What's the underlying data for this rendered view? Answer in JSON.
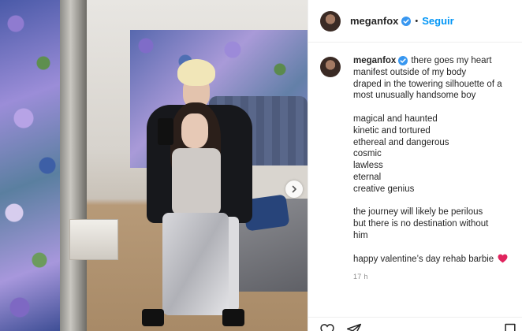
{
  "post": {
    "username": "meganfox",
    "dot": "•",
    "follow_label": "Seguir",
    "caption_lines": [
      "there goes my heart",
      "manifest outside of my body",
      "draped in the towering silhouette of a",
      "most unusually handsome boy"
    ],
    "stanza2": [
      "magical and haunted",
      "kinetic and tortured",
      "ethereal and dangerous",
      "cosmic",
      "lawless",
      "eternal",
      "creative genius"
    ],
    "stanza3": [
      "the journey will likely be perilous",
      "but there is no destination without",
      "him"
    ],
    "closing": "happy valentine’s day rehab barbie",
    "timestamp": "17 h"
  },
  "icons": {
    "verified": "verified-badge-icon",
    "heart_emoji": "red-heart-emoji-icon",
    "next": "chevron-right-icon",
    "like": "heart-outline-icon",
    "share": "paper-plane-icon",
    "save": "bookmark-icon"
  },
  "colors": {
    "accent_blue": "#0095f6",
    "text": "#262626",
    "muted": "#8e8e8e",
    "heart_red": "#e0245e"
  }
}
